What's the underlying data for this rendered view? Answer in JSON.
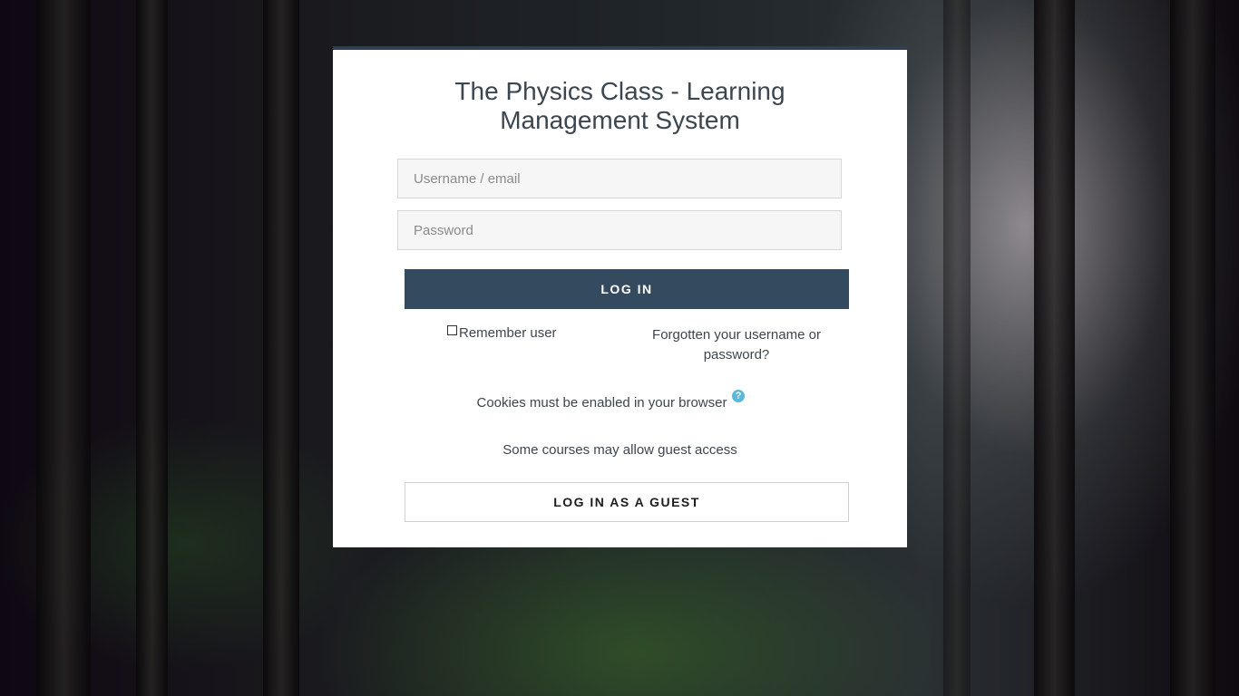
{
  "page": {
    "title": "The Physics Class - Learning Management System"
  },
  "login_form": {
    "username_placeholder": "Username / email",
    "username_value": "",
    "password_placeholder": "Password",
    "password_value": "",
    "login_button": "LOG IN",
    "remember_label": "Remember user",
    "remember_checked": false,
    "forgot_link": "Forgotten your username or password?",
    "cookies_notice": "Cookies must be enabled in your browser",
    "help_icon": "question-circle-icon",
    "help_icon_glyph": "?",
    "guest_note": "Some courses may allow guest access",
    "guest_button": "LOG IN AS A GUEST"
  },
  "colors": {
    "primary_button": "#344a5f",
    "help_icon": "#5bb8d9",
    "text": "#3b4650"
  }
}
